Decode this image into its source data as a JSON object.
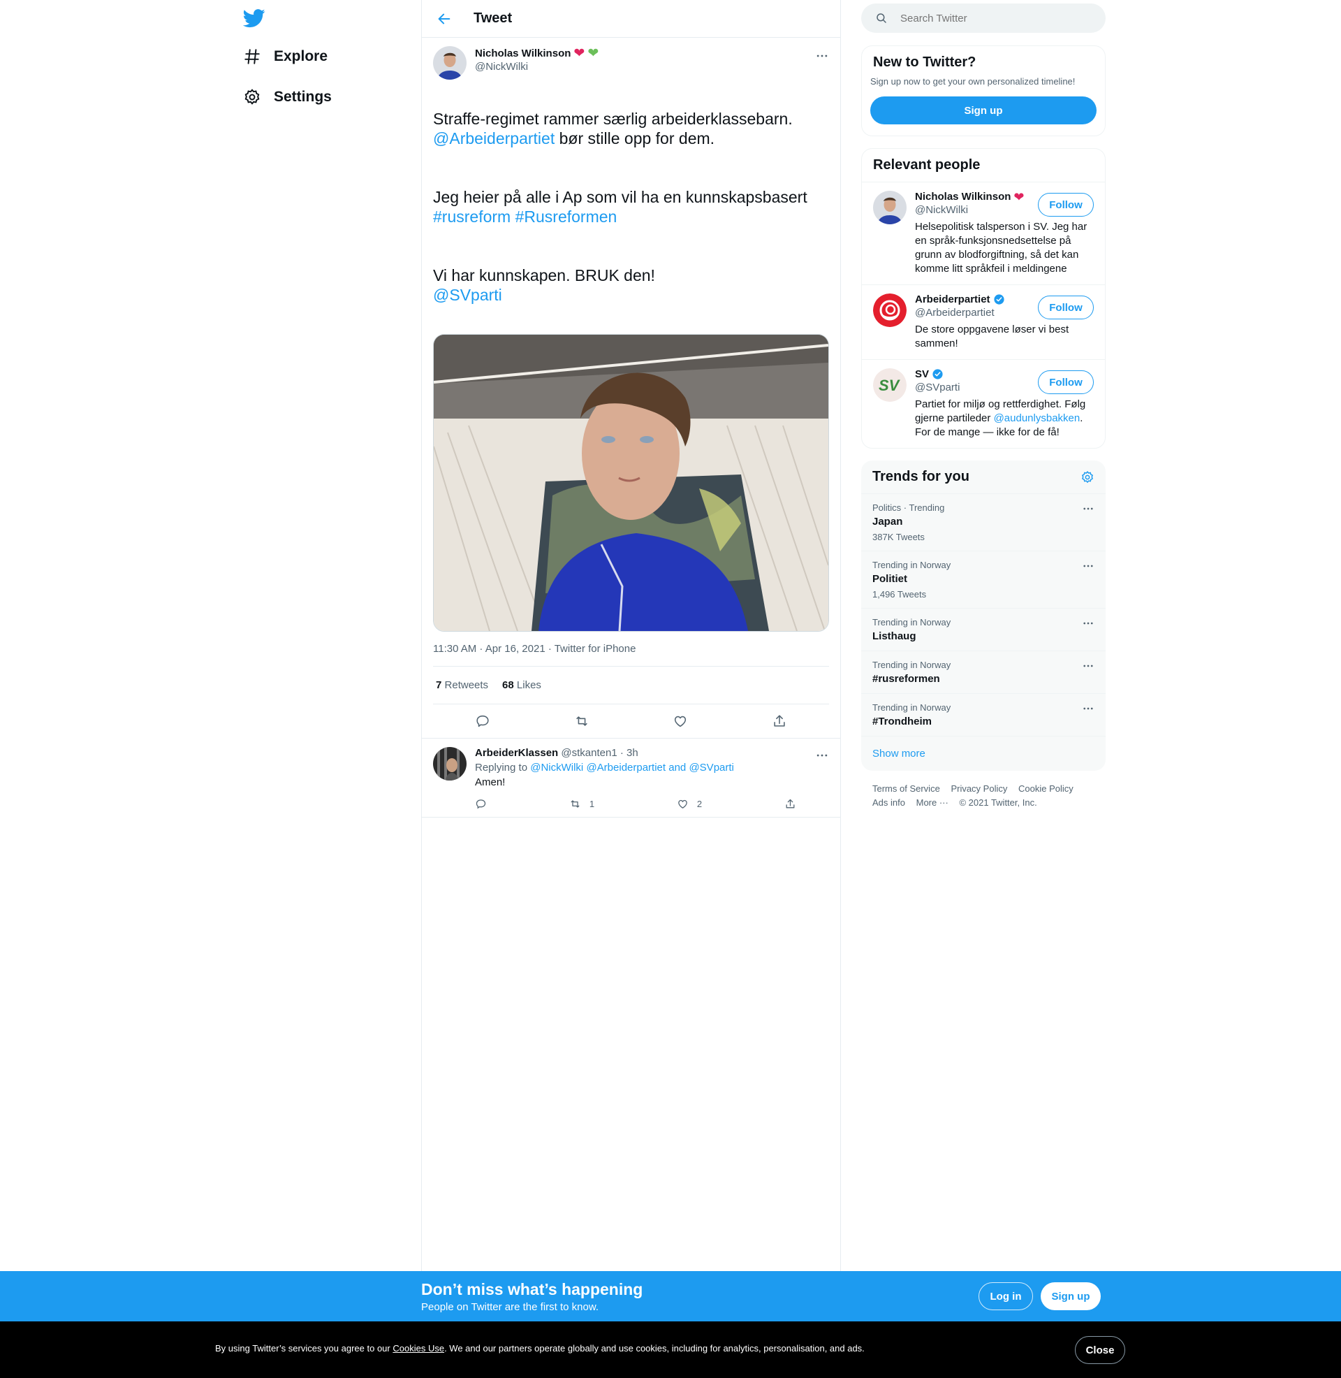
{
  "nav": {
    "explore": "Explore",
    "settings": "Settings"
  },
  "header": {
    "title": "Tweet"
  },
  "tweet": {
    "author_name": "Nicholas Wilkinson",
    "author_handle": "@NickWilki",
    "line1": "Straffe-regimet rammer særlig arbeiderklassebarn.",
    "mention1": "@Arbeiderpartiet",
    "line1b": " bør stille opp for dem.",
    "line2": "Jeg heier på alle i Ap som vil ha en kunnskapsbasert",
    "hashtag1": "#rusreform",
    "hashtag2": "#Rusreformen",
    "line3": "Vi har kunnskapen. BRUK den!",
    "mention2": "@SVparti",
    "meta": "11:30 AM · Apr 16, 2021 · Twitter for iPhone",
    "retweets_count": "7",
    "retweets_label": "Retweets",
    "likes_count": "68",
    "likes_label": "Likes"
  },
  "reply": {
    "name": "ArbeiderKlassen",
    "handle_time": "@stkanten1 · 3h",
    "replying_label": "Replying to",
    "replying_to1": "@NickWilki",
    "replying_to2": "@Arbeiderpartiet",
    "and": "and",
    "replying_to3": "@SVparti",
    "text": "Amen!",
    "retweets": "1",
    "likes": "2"
  },
  "search": {
    "placeholder": "Search Twitter"
  },
  "signup_card": {
    "title": "New to Twitter?",
    "subtitle": "Sign up now to get your own personalized timeline!",
    "button": "Sign up"
  },
  "relevant": {
    "title": "Relevant people",
    "follow_label": "Follow",
    "people": [
      {
        "name": "Nicholas Wilkinson",
        "handle": "@NickWilki",
        "bio": "Helsepolitisk talsperson i SV. Jeg har en språk-funksjonsnedsettelse på grunn av blodforgiftning, så det kan komme litt språkfeil i meldingene"
      },
      {
        "name": "Arbeiderpartiet",
        "handle": "@Arbeiderpartiet",
        "bio": "De store oppgavene løser vi best sammen!"
      },
      {
        "name": "SV",
        "handle": "@SVparti",
        "bio_pre": "Partiet for miljø og rettferdighet. Følg gjerne partileder ",
        "bio_link": "@audunlysbakken",
        "bio_post": ". For de mange — ikke for de få!",
        "avatar_text": "SV"
      }
    ]
  },
  "trends": {
    "title": "Trends for you",
    "items": [
      {
        "context": "Politics · Trending",
        "name": "Japan",
        "count": "387K Tweets"
      },
      {
        "context": "Trending in Norway",
        "name": "Politiet",
        "count": "1,496 Tweets"
      },
      {
        "context": "Trending in Norway",
        "name": "Listhaug",
        "count": ""
      },
      {
        "context": "Trending in Norway",
        "name": "#rusreformen",
        "count": ""
      },
      {
        "context": "Trending in Norway",
        "name": "#Trondheim",
        "count": ""
      }
    ],
    "show_more": "Show more"
  },
  "footer": {
    "terms": "Terms of Service",
    "privacy": "Privacy Policy",
    "cookie": "Cookie Policy",
    "ads": "Ads info",
    "more": "More ···",
    "copyright": "© 2021 Twitter, Inc."
  },
  "bottom": {
    "title": "Don’t miss what’s happening",
    "subtitle": "People on Twitter are the first to know.",
    "login": "Log in",
    "signup": "Sign up"
  },
  "cookies": {
    "pre": "By using Twitter’s services you agree to our ",
    "link": "Cookies Use",
    "post": ". We and our partners operate globally and use cookies, including for analytics, personalisation, and ads.",
    "close": "Close"
  },
  "colors": {
    "accent": "#1d9bf0",
    "heart": "#e0245e",
    "green_heart": "#6cbf5a"
  }
}
